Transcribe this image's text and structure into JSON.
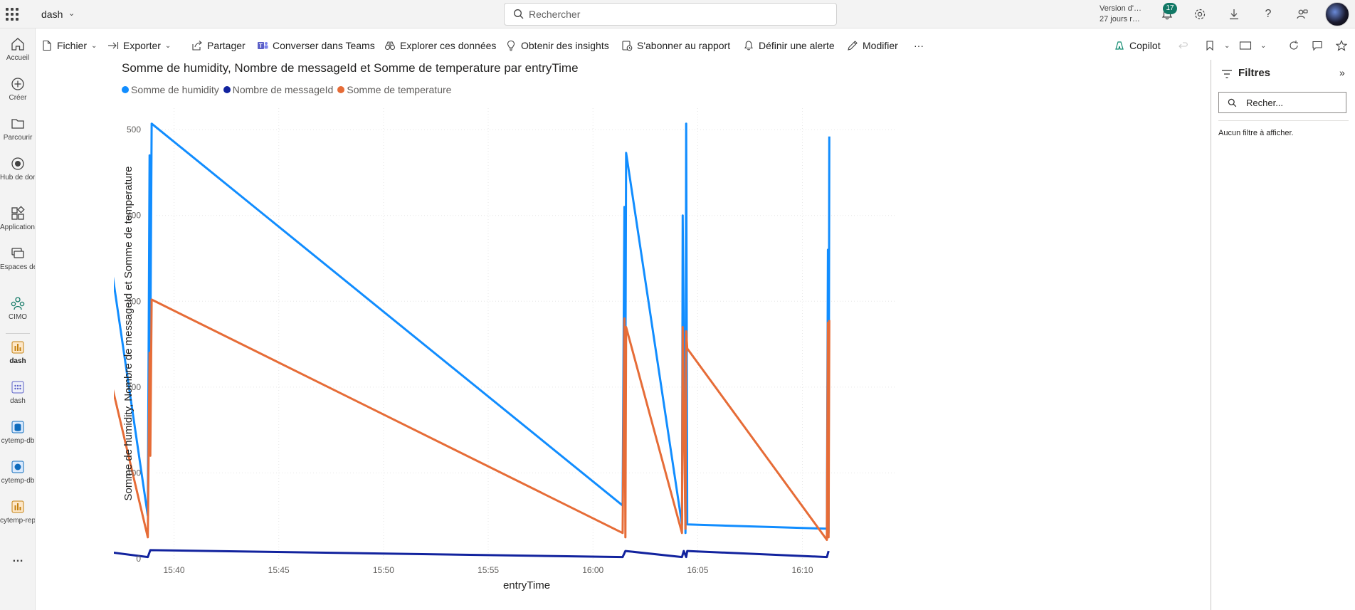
{
  "app": {
    "title": "dash"
  },
  "search": {
    "placeholder": "Rechercher"
  },
  "trial": {
    "line1": "Version d'…",
    "line2": "27 jours r…"
  },
  "notifications": {
    "count": "17"
  },
  "nav": {
    "items": [
      {
        "label": "Accueil",
        "icon": "home-icon"
      },
      {
        "label": "Créer",
        "icon": "plus-circle-icon"
      },
      {
        "label": "Parcourir",
        "icon": "folder-icon"
      },
      {
        "label": "Hub de données…",
        "icon": "data-hub-icon"
      },
      {
        "label": "Applications",
        "icon": "apps-icon"
      },
      {
        "label": "Espaces de travail",
        "icon": "workspaces-icon"
      },
      {
        "label": "CIMO",
        "icon": "workspace-group-icon"
      },
      {
        "label": "dash",
        "icon": "report-icon"
      },
      {
        "label": "dash",
        "icon": "dashboard-icon"
      },
      {
        "label": "cytemp-db",
        "icon": "database-icon"
      },
      {
        "label": "cytemp-db",
        "icon": "semantic-model-icon"
      },
      {
        "label": "cytemp-report",
        "icon": "report-icon"
      }
    ],
    "more": "…"
  },
  "toolbar": {
    "fichier": "Fichier",
    "exporter": "Exporter",
    "partager": "Partager",
    "teams": "Converser dans Teams",
    "explorer": "Explorer ces données",
    "insights": "Obtenir des insights",
    "abonner": "S'abonner au rapport",
    "alerte": "Définir une alerte",
    "modifier": "Modifier",
    "more": "···",
    "copilot": "Copilot"
  },
  "filters": {
    "title": "Filtres",
    "search_placeholder": "Recher...",
    "empty": "Aucun filtre à afficher."
  },
  "chart_data": {
    "type": "line",
    "title": "Somme de humidity, Nombre de messageId et Somme de temperature par entryTime",
    "xlabel": "entryTime",
    "ylabel": "Somme de humidity, Nombre de messageId et Somme de temperature",
    "x_ticks": [
      "15:40",
      "15:45",
      "15:50",
      "15:55",
      "16:00",
      "16:05",
      "16:10"
    ],
    "y_ticks": [
      "0",
      "100",
      "200",
      "300",
      "400",
      "500"
    ],
    "ylim": [
      0,
      525
    ],
    "legend_position": "top-left",
    "grid": true,
    "series": [
      {
        "name": "Somme de humidity",
        "color": "#118DFF",
        "x": [
          "15:36:08",
          "15:36:09",
          "15:36:10",
          "15:36:12",
          "15:38:45",
          "15:38:50",
          "15:38:52",
          "15:38:56",
          "16:01:25",
          "16:01:30",
          "16:01:33",
          "16:01:35",
          "16:04:15",
          "16:04:17",
          "16:04:25",
          "16:04:27",
          "16:04:30",
          "16:11:10",
          "16:11:13",
          "16:11:15",
          "16:11:17"
        ],
        "values": [
          60,
          495,
          350,
          475,
          50,
          470,
          240,
          507,
          62,
          410,
          210,
          473,
          40,
          400,
          30,
          507,
          40,
          35,
          360,
          30,
          492
        ]
      },
      {
        "name": "Nombre de messageId",
        "color": "#12239E",
        "x": [
          "15:36:08",
          "15:36:10",
          "15:38:45",
          "15:38:52",
          "16:01:25",
          "16:01:33",
          "16:04:15",
          "16:04:20",
          "16:04:27",
          "16:04:30",
          "16:11:10",
          "16:11:15"
        ],
        "values": [
          2,
          10,
          2,
          10,
          2,
          9,
          2,
          9,
          2,
          9,
          2,
          9
        ]
      },
      {
        "name": "Somme de temperature",
        "color": "#E66C37",
        "x": [
          "15:36:08",
          "15:36:09",
          "15:36:10",
          "15:36:12",
          "15:38:45",
          "15:38:50",
          "15:38:52",
          "15:38:56",
          "16:01:25",
          "16:01:30",
          "16:01:33",
          "16:01:35",
          "16:04:15",
          "16:04:17",
          "16:04:25",
          "16:04:27",
          "16:04:30",
          "16:11:10",
          "16:11:13",
          "16:11:15",
          "16:11:17"
        ],
        "values": [
          25,
          290,
          30,
          288,
          25,
          240,
          120,
          302,
          30,
          280,
          25,
          270,
          30,
          270,
          35,
          265,
          245,
          22,
          275,
          25,
          278
        ]
      }
    ]
  }
}
